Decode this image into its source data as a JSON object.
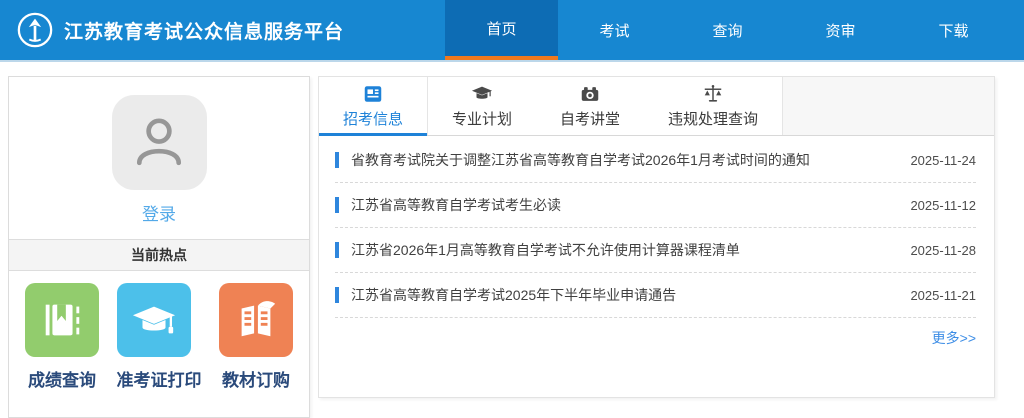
{
  "colors": {
    "header_bg": "#1787d1",
    "header_active_bg": "#0d6cb4",
    "header_active_underline": "#f0791d",
    "accent_blue": "#1e82d8",
    "link_blue": "#3e8ee6",
    "login_blue": "#53a9e8",
    "tile_green": "#92cc6d",
    "tile_blue": "#4cc0ea",
    "tile_orange": "#ef8254",
    "tile_label": "#2a4a7b"
  },
  "header": {
    "title": "江苏教育考试公众信息服务平台",
    "nav": [
      {
        "label": "首页",
        "active": true
      },
      {
        "label": "考试",
        "active": false
      },
      {
        "label": "查询",
        "active": false
      },
      {
        "label": "资审",
        "active": false
      },
      {
        "label": "下载",
        "active": false
      }
    ]
  },
  "sidebar": {
    "login_label": "登录",
    "hot_title": "当前热点",
    "shortcuts": [
      {
        "label": "成绩查询",
        "icon": "book-bookmark-icon",
        "color": "#92cc6d"
      },
      {
        "label": "准考证打印",
        "icon": "graduation-cap-icon",
        "color": "#4cc0ea"
      },
      {
        "label": "教材订购",
        "icon": "open-book-icon",
        "color": "#ef8254"
      }
    ]
  },
  "main": {
    "tabs": [
      {
        "label": "招考信息",
        "icon": "newspaper-icon",
        "active": true
      },
      {
        "label": "专业计划",
        "icon": "graduation-cap-icon",
        "active": false
      },
      {
        "label": "自考讲堂",
        "icon": "lecture-hall-icon",
        "active": false
      },
      {
        "label": "违规处理查询",
        "icon": "scales-icon",
        "active": false
      }
    ],
    "news": [
      {
        "title": "省教育考试院关于调整江苏省高等教育自学考试2026年1月考试时间的通知",
        "date": "2025-11-24"
      },
      {
        "title": "江苏省高等教育自学考试考生必读",
        "date": "2025-11-12"
      },
      {
        "title": "江苏省2026年1月高等教育自学考试不允许使用计算器课程清单",
        "date": "2025-11-28"
      },
      {
        "title": "江苏省高等教育自学考试2025年下半年毕业申请通告",
        "date": "2025-11-21"
      }
    ],
    "more_label": "更多>>"
  }
}
